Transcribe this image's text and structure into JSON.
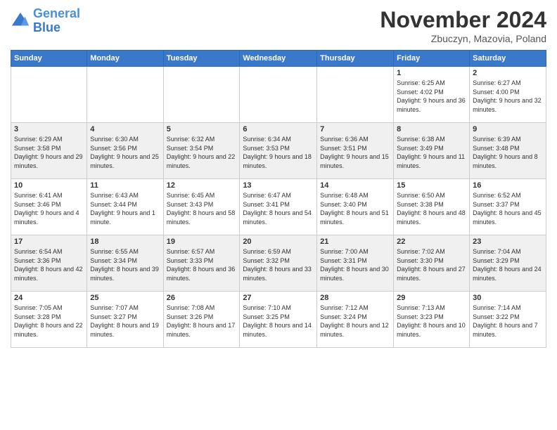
{
  "logo": {
    "line1": "General",
    "line2": "Blue"
  },
  "title": "November 2024",
  "subtitle": "Zbuczyn, Mazovia, Poland",
  "days_of_week": [
    "Sunday",
    "Monday",
    "Tuesday",
    "Wednesday",
    "Thursday",
    "Friday",
    "Saturday"
  ],
  "weeks": [
    [
      {
        "day": "",
        "info": ""
      },
      {
        "day": "",
        "info": ""
      },
      {
        "day": "",
        "info": ""
      },
      {
        "day": "",
        "info": ""
      },
      {
        "day": "",
        "info": ""
      },
      {
        "day": "1",
        "info": "Sunrise: 6:25 AM\nSunset: 4:02 PM\nDaylight: 9 hours and 36 minutes."
      },
      {
        "day": "2",
        "info": "Sunrise: 6:27 AM\nSunset: 4:00 PM\nDaylight: 9 hours and 32 minutes."
      }
    ],
    [
      {
        "day": "3",
        "info": "Sunrise: 6:29 AM\nSunset: 3:58 PM\nDaylight: 9 hours and 29 minutes."
      },
      {
        "day": "4",
        "info": "Sunrise: 6:30 AM\nSunset: 3:56 PM\nDaylight: 9 hours and 25 minutes."
      },
      {
        "day": "5",
        "info": "Sunrise: 6:32 AM\nSunset: 3:54 PM\nDaylight: 9 hours and 22 minutes."
      },
      {
        "day": "6",
        "info": "Sunrise: 6:34 AM\nSunset: 3:53 PM\nDaylight: 9 hours and 18 minutes."
      },
      {
        "day": "7",
        "info": "Sunrise: 6:36 AM\nSunset: 3:51 PM\nDaylight: 9 hours and 15 minutes."
      },
      {
        "day": "8",
        "info": "Sunrise: 6:38 AM\nSunset: 3:49 PM\nDaylight: 9 hours and 11 minutes."
      },
      {
        "day": "9",
        "info": "Sunrise: 6:39 AM\nSunset: 3:48 PM\nDaylight: 9 hours and 8 minutes."
      }
    ],
    [
      {
        "day": "10",
        "info": "Sunrise: 6:41 AM\nSunset: 3:46 PM\nDaylight: 9 hours and 4 minutes."
      },
      {
        "day": "11",
        "info": "Sunrise: 6:43 AM\nSunset: 3:44 PM\nDaylight: 9 hours and 1 minute."
      },
      {
        "day": "12",
        "info": "Sunrise: 6:45 AM\nSunset: 3:43 PM\nDaylight: 8 hours and 58 minutes."
      },
      {
        "day": "13",
        "info": "Sunrise: 6:47 AM\nSunset: 3:41 PM\nDaylight: 8 hours and 54 minutes."
      },
      {
        "day": "14",
        "info": "Sunrise: 6:48 AM\nSunset: 3:40 PM\nDaylight: 8 hours and 51 minutes."
      },
      {
        "day": "15",
        "info": "Sunrise: 6:50 AM\nSunset: 3:38 PM\nDaylight: 8 hours and 48 minutes."
      },
      {
        "day": "16",
        "info": "Sunrise: 6:52 AM\nSunset: 3:37 PM\nDaylight: 8 hours and 45 minutes."
      }
    ],
    [
      {
        "day": "17",
        "info": "Sunrise: 6:54 AM\nSunset: 3:36 PM\nDaylight: 8 hours and 42 minutes."
      },
      {
        "day": "18",
        "info": "Sunrise: 6:55 AM\nSunset: 3:34 PM\nDaylight: 8 hours and 39 minutes."
      },
      {
        "day": "19",
        "info": "Sunrise: 6:57 AM\nSunset: 3:33 PM\nDaylight: 8 hours and 36 minutes."
      },
      {
        "day": "20",
        "info": "Sunrise: 6:59 AM\nSunset: 3:32 PM\nDaylight: 8 hours and 33 minutes."
      },
      {
        "day": "21",
        "info": "Sunrise: 7:00 AM\nSunset: 3:31 PM\nDaylight: 8 hours and 30 minutes."
      },
      {
        "day": "22",
        "info": "Sunrise: 7:02 AM\nSunset: 3:30 PM\nDaylight: 8 hours and 27 minutes."
      },
      {
        "day": "23",
        "info": "Sunrise: 7:04 AM\nSunset: 3:29 PM\nDaylight: 8 hours and 24 minutes."
      }
    ],
    [
      {
        "day": "24",
        "info": "Sunrise: 7:05 AM\nSunset: 3:28 PM\nDaylight: 8 hours and 22 minutes."
      },
      {
        "day": "25",
        "info": "Sunrise: 7:07 AM\nSunset: 3:27 PM\nDaylight: 8 hours and 19 minutes."
      },
      {
        "day": "26",
        "info": "Sunrise: 7:08 AM\nSunset: 3:26 PM\nDaylight: 8 hours and 17 minutes."
      },
      {
        "day": "27",
        "info": "Sunrise: 7:10 AM\nSunset: 3:25 PM\nDaylight: 8 hours and 14 minutes."
      },
      {
        "day": "28",
        "info": "Sunrise: 7:12 AM\nSunset: 3:24 PM\nDaylight: 8 hours and 12 minutes."
      },
      {
        "day": "29",
        "info": "Sunrise: 7:13 AM\nSunset: 3:23 PM\nDaylight: 8 hours and 10 minutes."
      },
      {
        "day": "30",
        "info": "Sunrise: 7:14 AM\nSunset: 3:22 PM\nDaylight: 8 hours and 7 minutes."
      }
    ]
  ]
}
